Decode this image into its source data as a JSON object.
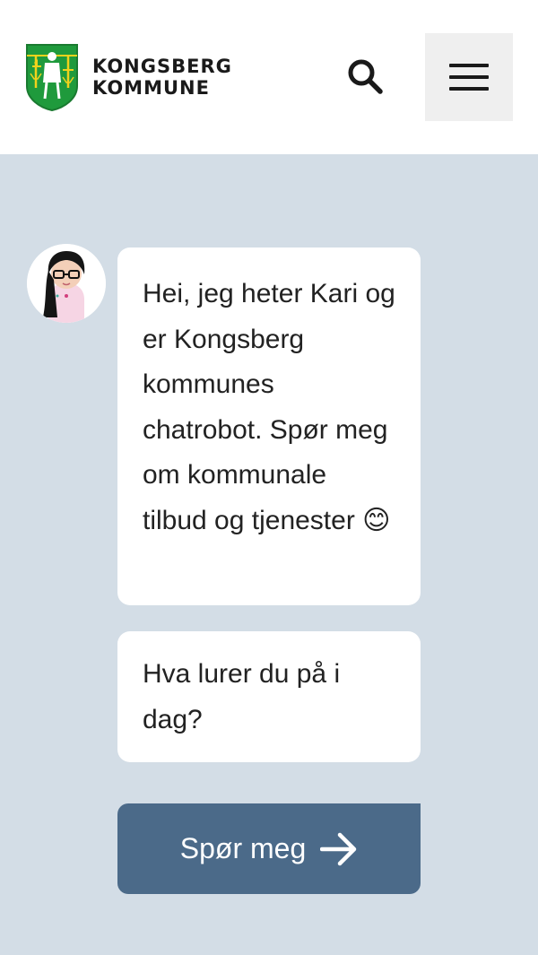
{
  "header": {
    "logo_line1": "KONGSBERG",
    "logo_line2": "KOMMUNE",
    "search_icon": "search-icon",
    "menu_icon": "hamburger-menu-icon"
  },
  "chat": {
    "avatar_icon": "chatbot-avatar",
    "message_1": "Hei, jeg heter Kari og er Kongsberg kommunes chatrobot. Spør meg om kommunale tilbud og tjenester 😊",
    "message_2": "Hva lurer du på i dag?",
    "ask_button_label": "Spør meg",
    "ask_button_icon": "arrow-right-icon"
  },
  "colors": {
    "background": "#d3dde6",
    "header_bg": "#ffffff",
    "menu_button_bg": "#efefef",
    "bubble_bg": "#ffffff",
    "button_bg": "#4b6a89",
    "crest_green": "#1f9a3c",
    "crest_yellow": "#f1d21c"
  }
}
